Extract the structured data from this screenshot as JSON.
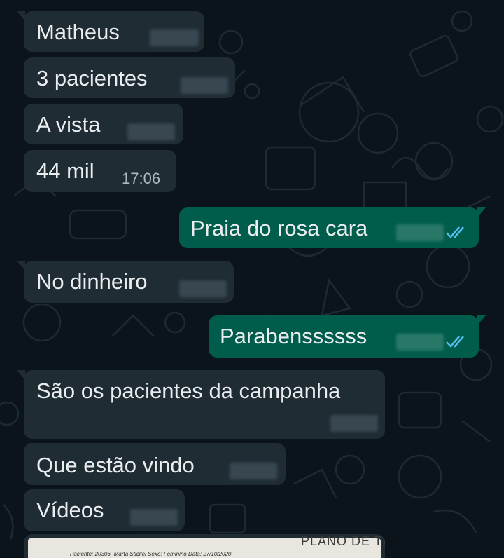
{
  "colors": {
    "background": "#0b141a",
    "incoming_bubble": "#202c33",
    "outgoing_bubble": "#005c4b",
    "text": "#e9edef",
    "read_ticks": "#53bdeb"
  },
  "messages": [
    {
      "direction": "incoming",
      "text": "Matheus"
    },
    {
      "direction": "incoming",
      "text": "3 pacientes"
    },
    {
      "direction": "incoming",
      "text": "A vista"
    },
    {
      "direction": "incoming",
      "text": "44 mil",
      "time": "17:06"
    },
    {
      "direction": "outgoing",
      "text": "Praia do rosa cara",
      "status": "read-ticks-icon"
    },
    {
      "direction": "incoming",
      "text": "No dinheiro"
    },
    {
      "direction": "outgoing",
      "text": "Parabenssssss",
      "status": "read-ticks-icon"
    },
    {
      "direction": "incoming",
      "text": "São os pacientes da campanha"
    },
    {
      "direction": "incoming",
      "text": "Que estão vindo"
    },
    {
      "direction": "incoming",
      "text": "Vídeos"
    }
  ],
  "attachment": {
    "type": "document-image-preview",
    "title": "PLANO DE TI",
    "line": "Paciente: 20306 -Marta Stickel   Sexo: Feminino   Data: 27/10/2020"
  }
}
